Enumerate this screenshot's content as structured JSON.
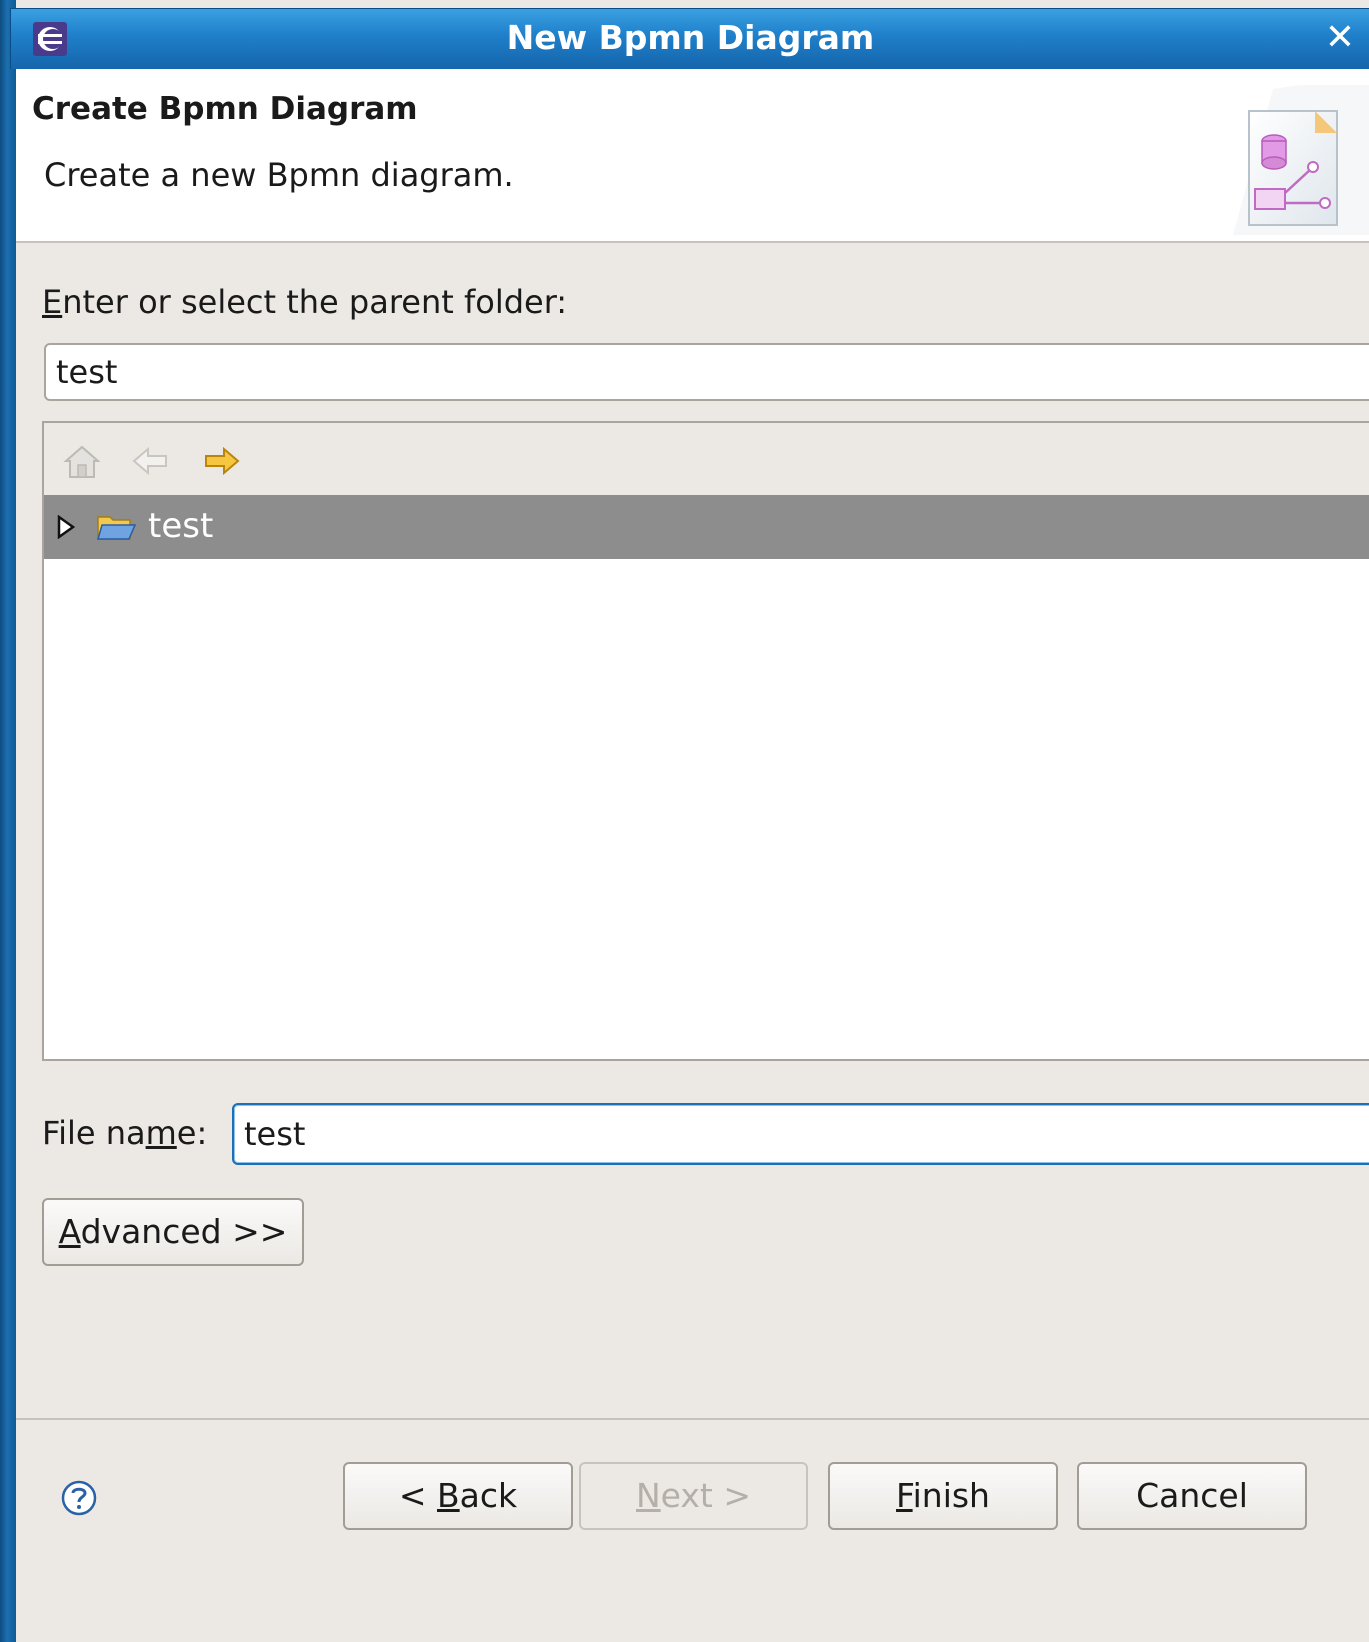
{
  "window": {
    "title": "New Bpmn Diagram",
    "close_glyph": "✕"
  },
  "header": {
    "title": "Create Bpmn Diagram",
    "description": "Create a new Bpmn diagram."
  },
  "parent_folder": {
    "label_mnemonic": "E",
    "label_rest": "nter or select the parent folder:",
    "value": "test"
  },
  "tree": {
    "toolbar": [
      "home-icon",
      "back-arrow-icon",
      "forward-arrow-icon"
    ],
    "items": [
      {
        "label": "test",
        "selected": true,
        "expanded": false
      }
    ]
  },
  "file_name": {
    "label_pre": "File na",
    "label_mnemonic": "m",
    "label_post": "e:",
    "value": "test"
  },
  "buttons": {
    "advanced": {
      "mnemonic": "A",
      "rest": "dvanced >>"
    },
    "back": {
      "pre": "< ",
      "mnemonic": "B",
      "rest": "ack"
    },
    "next": {
      "mnemonic": "N",
      "rest": "ext >"
    },
    "finish": {
      "mnemonic": "F",
      "rest": "inish"
    },
    "cancel": "Cancel"
  },
  "colors": {
    "titlebar": "#1f7fc9",
    "selection": "#8d8d8d",
    "focus_border": "#1f6fb5",
    "forward_arrow": "#f2b21b"
  }
}
